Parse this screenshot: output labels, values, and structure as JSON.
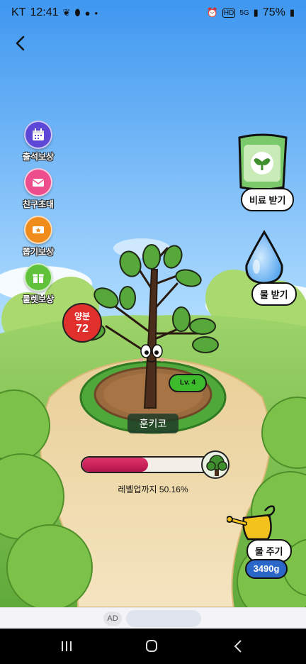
{
  "status_bar": {
    "carrier": "KT",
    "time": "12:41",
    "battery": "75%",
    "left_icons": [
      "leaf-icon",
      "pill-icon",
      "talk-icon"
    ],
    "right_icons": [
      "alarm-icon",
      "hd-icon",
      "lte-icon",
      "signal-icon",
      "battery-icon"
    ]
  },
  "menu": [
    {
      "label": "출석보상",
      "icon": "calendar-icon",
      "color": "#5c47d6"
    },
    {
      "label": "친구초대",
      "icon": "mail-icon",
      "color": "#ee4d8c"
    },
    {
      "label": "뽑기보상",
      "icon": "ticket-icon",
      "color": "#f08c1c"
    },
    {
      "label": "룰렛보상",
      "icon": "gift-icon",
      "color": "#5fc23a"
    }
  ],
  "fertilizer": {
    "label": "비료 받기"
  },
  "get_water": {
    "label": "물 받기"
  },
  "nutrient": {
    "label": "양분",
    "value": "72"
  },
  "tree": {
    "level": "Lv. 4",
    "name": "훈키코"
  },
  "progress": {
    "percent": 50.16,
    "text": "레벨업까지 50.16%"
  },
  "give_water": {
    "label": "물 주기",
    "amount": "3490g"
  },
  "ad": {
    "label": "AD"
  },
  "colors": {
    "sky_top": "#3f97f0",
    "grass": "#7cc24a",
    "path": "#efd8a9",
    "accent_red": "#e0302c",
    "accent_blue": "#2b66c9"
  }
}
